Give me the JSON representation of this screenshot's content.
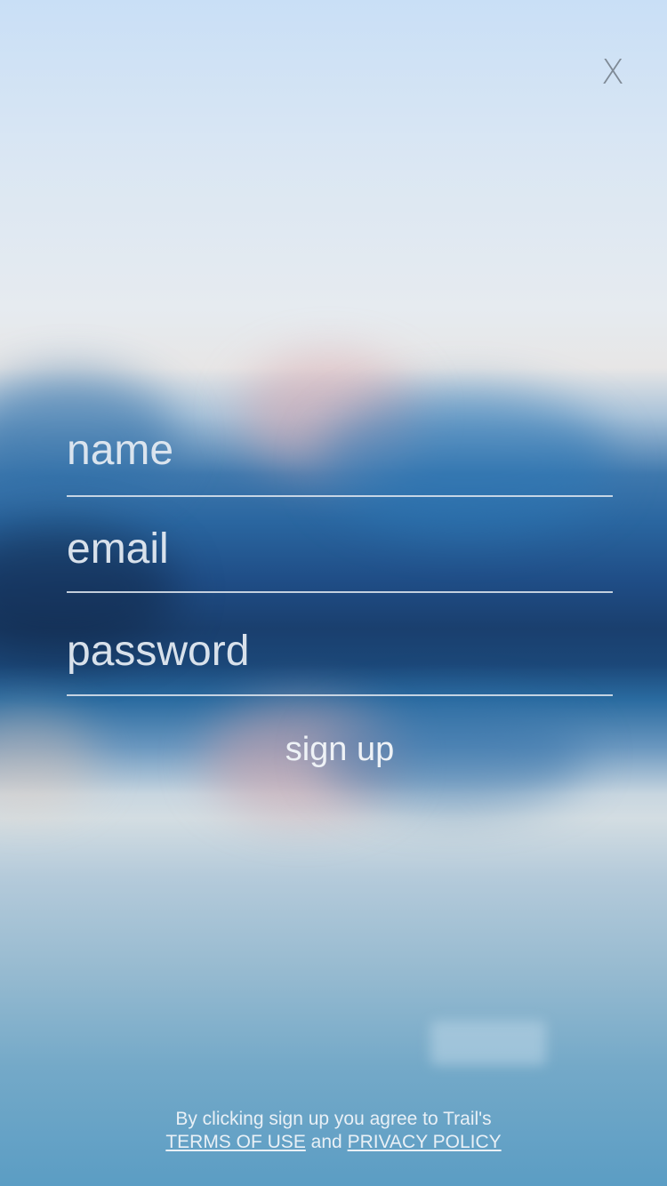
{
  "close_label": "X",
  "form": {
    "name_placeholder": "name",
    "email_placeholder": "email",
    "password_placeholder": "password",
    "signup_label": "sign up"
  },
  "social": {
    "left_label": "",
    "right_label": ""
  },
  "footer": {
    "line1": "By clicking sign up you agree to Trail's",
    "terms_label": "TERMS OF USE",
    "and_text": "and",
    "privacy_label": "PRIVACY POLICY"
  }
}
